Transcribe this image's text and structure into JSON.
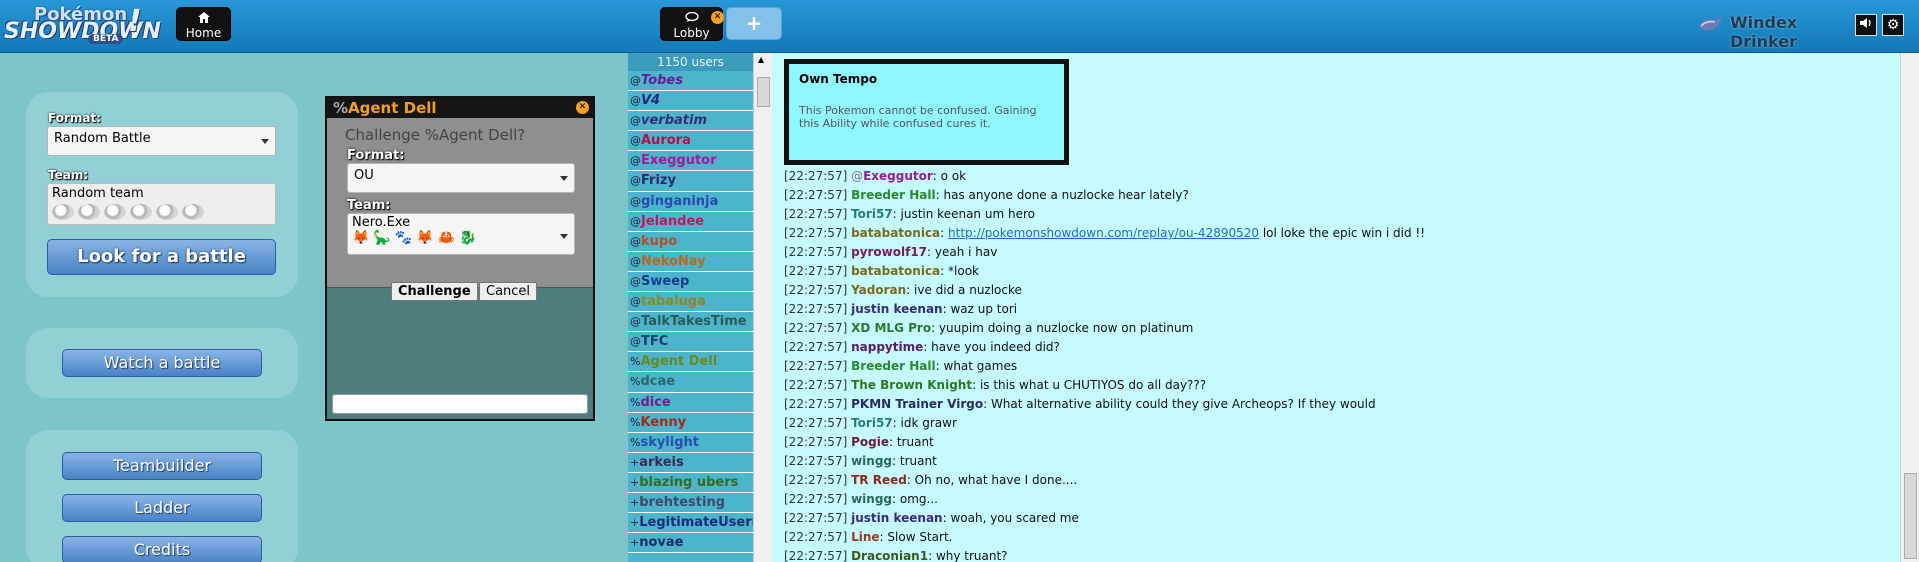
{
  "header": {
    "logo": {
      "line1": "Pokémon",
      "line2": "SHOWDOWN",
      "bang": "!",
      "beta": "BETA"
    },
    "home_label": "Home",
    "lobby_label": "Lobby",
    "new_tab_label": "+",
    "username": "Windex Drinker",
    "icons": [
      "house-icon",
      "chat-bubble-icon",
      "close-icon",
      "speaker-icon",
      "gear-icon"
    ]
  },
  "main_menu": {
    "format_label": "Format:",
    "format_value": "Random Battle",
    "team_label": "Team:",
    "team_value": "Random team",
    "look_button": "Look for a battle",
    "watch_button": "Watch a battle",
    "teambuilder_button": "Teambuilder",
    "ladder_button": "Ladder",
    "credits_button": "Credits"
  },
  "challenge": {
    "title_prefix": "%",
    "title_name": "Agent Dell",
    "question": "Challenge %Agent Dell?",
    "format_label": "Format:",
    "format_value": "OU",
    "team_label": "Team:",
    "team_value": "Nero.Exe",
    "challenge_button": "Challenge",
    "cancel_button": "Cancel"
  },
  "userlist": {
    "count": "1150 users",
    "users": [
      {
        "g": "@",
        "n": "Tobes",
        "c": "#6a1b9a",
        "i": true
      },
      {
        "g": "@",
        "n": "V4",
        "c": "#1f2a7a",
        "i": true
      },
      {
        "g": "@",
        "n": "verbatim",
        "c": "#3b2a7a",
        "i": true
      },
      {
        "g": "@",
        "n": "Aurora",
        "c": "#b01050",
        "i": false
      },
      {
        "g": "@",
        "n": "Exeggutor",
        "c": "#a5199a",
        "i": false
      },
      {
        "g": "@",
        "n": "Frizy",
        "c": "#2a2a6a",
        "i": false
      },
      {
        "g": "@",
        "n": "ginganinja",
        "c": "#2a48b0",
        "i": false
      },
      {
        "g": "@",
        "n": "Jelandee",
        "c": "#c01860",
        "i": false
      },
      {
        "g": "@",
        "n": "kupo",
        "c": "#b45020",
        "i": false
      },
      {
        "g": "@",
        "n": "NekoNay",
        "c": "#b66a1a",
        "i": false
      },
      {
        "g": "@",
        "n": "Sweep",
        "c": "#1a3a8a",
        "i": false
      },
      {
        "g": "@",
        "n": "tabaluga",
        "c": "#8a8a20",
        "i": false
      },
      {
        "g": "@",
        "n": "TalkTakesTime",
        "c": "#2a5a5a",
        "i": false
      },
      {
        "g": "@",
        "n": "TFC",
        "c": "#1a3a6a",
        "i": false
      },
      {
        "g": "%",
        "n": "Agent Dell",
        "c": "#6a8a1a",
        "i": false
      },
      {
        "g": "%",
        "n": "dcae",
        "c": "#2a6a6a",
        "i": false
      },
      {
        "g": "%",
        "n": "dice",
        "c": "#7a1a8a",
        "i": false
      },
      {
        "g": "%",
        "n": "Kenny",
        "c": "#a02a20",
        "i": false
      },
      {
        "g": "%",
        "n": "skylight",
        "c": "#2a4ab0",
        "i": false
      },
      {
        "g": "+",
        "n": "arkeis",
        "c": "#3a2a5a",
        "i": false
      },
      {
        "g": "+",
        "n": "blazing ubers",
        "c": "#3a6a1a",
        "i": false
      },
      {
        "g": "+",
        "n": "brehtesting",
        "c": "#3a4a6a",
        "i": false
      },
      {
        "g": "+",
        "n": "LegitimateUsername",
        "c": "#1a2a7a",
        "i": false
      },
      {
        "g": "+",
        "n": "novae",
        "c": "#1a2a6a",
        "i": false
      }
    ]
  },
  "tooltip": {
    "title": "Own Tempo",
    "description": "This Pokemon cannot be confused. Gaining this Ability while confused cures it."
  },
  "chat": {
    "lines": [
      {
        "t": "[22:27:57]",
        "g": "@",
        "n": "Exeggutor",
        "c": "#9a1a9a",
        "m": "o ok"
      },
      {
        "t": "[22:27:57]",
        "g": "",
        "n": "Breeder Hall",
        "c": "#2a8a2a",
        "m": "has anyone done a nuzlocke hear lately?"
      },
      {
        "t": "[22:27:57]",
        "g": "",
        "n": "Tori57",
        "c": "#2a7a7a",
        "m": "justin keenan um hero"
      },
      {
        "t": "[22:27:57]",
        "g": "",
        "n": "batabatonica",
        "c": "#7a6a1a",
        "m": "",
        "link": "http://pokemonshowdown.com/replay/ou-42890520",
        "after": "lol loke the epic win i did !!"
      },
      {
        "t": "[22:27:57]",
        "g": "",
        "n": "pyrowolf17",
        "c": "#7a1a5a",
        "m": "yeah i hav"
      },
      {
        "t": "[22:27:57]",
        "g": "",
        "n": "batabatonica",
        "c": "#7a6a1a",
        "m": "*look"
      },
      {
        "t": "[22:27:57]",
        "g": "",
        "n": "Yadoran",
        "c": "#7a6a1a",
        "m": "ive did a nuzlocke"
      },
      {
        "t": "[22:27:57]",
        "g": "",
        "n": "justin keenan",
        "c": "#3a2a7a",
        "m": "waz up tori"
      },
      {
        "t": "[22:27:57]",
        "g": "",
        "n": "XD MLG Pro",
        "c": "#2a7a2a",
        "m": "yuupim doing a nuzlocke now on platinum"
      },
      {
        "t": "[22:27:57]",
        "g": "",
        "n": "nappytime",
        "c": "#5a1a6a",
        "m": "have you indeed did?"
      },
      {
        "t": "[22:27:57]",
        "g": "",
        "n": "Breeder Hall",
        "c": "#2a8a2a",
        "m": "what games"
      },
      {
        "t": "[22:27:57]",
        "g": "",
        "n": "The Brown Knight",
        "c": "#2a7a1a",
        "m": "is this what u CHUTIYOS do all day???"
      },
      {
        "t": "[22:27:57]",
        "g": "",
        "n": "PKMN Trainer Virgo",
        "c": "#2a2a6a",
        "m": "What alternative ability could they give Archeops? If they would"
      },
      {
        "t": "[22:27:57]",
        "g": "",
        "n": "Tori57",
        "c": "#2a7a7a",
        "m": "idk grawr"
      },
      {
        "t": "[22:27:57]",
        "g": "",
        "n": "Pogie",
        "c": "#6a1a3a",
        "m": "truant"
      },
      {
        "t": "[22:27:57]",
        "g": "",
        "n": "wingg",
        "c": "#2a6a5a",
        "m": "truant"
      },
      {
        "t": "[22:27:57]",
        "g": "",
        "n": "TR Reed",
        "c": "#8a2a1a",
        "m": "Oh no, what have I done...."
      },
      {
        "t": "[22:27:57]",
        "g": "",
        "n": "wingg",
        "c": "#2a6a5a",
        "m": "omg..."
      },
      {
        "t": "[22:27:57]",
        "g": "",
        "n": "justin keenan",
        "c": "#3a2a7a",
        "m": "woah, you scared me"
      },
      {
        "t": "[22:27:57]",
        "g": "",
        "n": "Line",
        "c": "#9a3a1a",
        "m": "Slow Start."
      },
      {
        "t": "[22:27:57]",
        "g": "",
        "n": "Draconian1",
        "c": "#3a5a1a",
        "m": "why truant?"
      }
    ]
  }
}
